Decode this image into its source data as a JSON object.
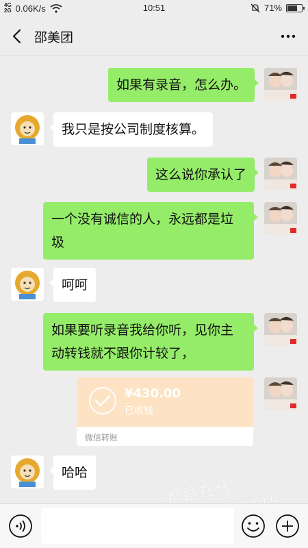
{
  "status_bar": {
    "signal_top": "4G",
    "signal_bottom": "2G",
    "speed": "0.06K/s",
    "time": "10:51",
    "battery": "71%",
    "battery_level": 0.71
  },
  "header": {
    "title": "邵美团"
  },
  "messages": [
    {
      "side": "me",
      "text": "如果有录音，怎么办。"
    },
    {
      "side": "other",
      "text": "我只是按公司制度核算。"
    },
    {
      "side": "me",
      "text": "这么说你承认了"
    },
    {
      "side": "me",
      "text": "一个没有诚信的人，永远都是垃\n圾"
    },
    {
      "side": "other",
      "text": "呵呵"
    },
    {
      "side": "me",
      "text": "如果要听录音我给你听，见你主\n动转钱就不跟你计较了，"
    },
    {
      "side": "other",
      "text": "哈哈"
    }
  ],
  "transfer": {
    "amount": "¥430.00",
    "status": "已收钱",
    "label": "微信转账"
  },
  "watermark": {
    "cn": "都昌在线",
    "en": "duchang.org"
  },
  "colors": {
    "bubble_me": "#95ec69",
    "bubble_other": "#ffffff",
    "transfer_bg": "#fde2c3",
    "background": "#ededed"
  }
}
